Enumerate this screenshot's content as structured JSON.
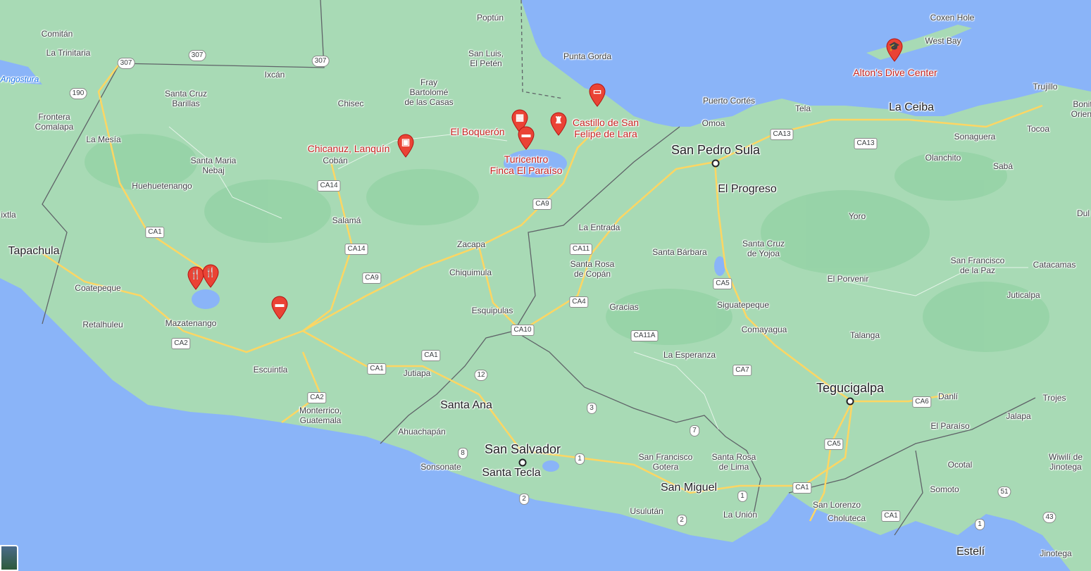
{
  "colors": {
    "water": "#8ab4f8",
    "land": "#a8dab5",
    "land_dark": "#94d2a5",
    "road": "#fdd663",
    "border": "#5f6368",
    "pin": "#ea4335"
  },
  "places": [
    {
      "name": "Comitán",
      "cls": "small"
    },
    {
      "name": "La Trinitaria",
      "cls": "small"
    },
    {
      "name": "Frontera\nComalapa",
      "cls": "small"
    },
    {
      "name": "La Mesía",
      "cls": "small"
    },
    {
      "name": "Santa Cruz\nBarillas",
      "cls": "small"
    },
    {
      "name": "Ixcán",
      "cls": "small"
    },
    {
      "name": "Chisec",
      "cls": "small"
    },
    {
      "name": "Fray\nBartolomé\nde las Casas",
      "cls": "small"
    },
    {
      "name": "Poptún",
      "cls": "small"
    },
    {
      "name": "San Luis,\nEl Petén",
      "cls": "small"
    },
    {
      "name": "Punta Gorda",
      "cls": "small"
    },
    {
      "name": "Santa Maria\nNebaj",
      "cls": "small"
    },
    {
      "name": "Huehuetenango",
      "cls": "small"
    },
    {
      "name": "Cobán",
      "cls": "small"
    },
    {
      "name": "Salamá",
      "cls": "small"
    },
    {
      "name": "Zacapa",
      "cls": "small"
    },
    {
      "name": "Chiquimula",
      "cls": "small"
    },
    {
      "name": "Esquipulas",
      "cls": "small"
    },
    {
      "name": "Jutiapa",
      "cls": "small"
    },
    {
      "name": "Coatepeque",
      "cls": "small"
    },
    {
      "name": "Retalhuleu",
      "cls": "small"
    },
    {
      "name": "Mazatenango",
      "cls": "small"
    },
    {
      "name": "Escuintla",
      "cls": "small"
    },
    {
      "name": "Monterrico,\nGuatemala",
      "cls": "small"
    },
    {
      "name": "Tapachula",
      "cls": "mid"
    },
    {
      "name": "ixtla",
      "cls": "small"
    },
    {
      "name": "Santa Ana",
      "cls": "mid"
    },
    {
      "name": "Ahuachapán",
      "cls": "small"
    },
    {
      "name": "Sonsonate",
      "cls": "small"
    },
    {
      "name": "San Salvador",
      "cls": "big"
    },
    {
      "name": "Santa Tecla",
      "cls": "mid"
    },
    {
      "name": "San Francisco\nGotera",
      "cls": "small"
    },
    {
      "name": "Santa Rosa\nde Lima",
      "cls": "small"
    },
    {
      "name": "San Miguel",
      "cls": "mid"
    },
    {
      "name": "Usulután",
      "cls": "small"
    },
    {
      "name": "La Unión",
      "cls": "small"
    },
    {
      "name": "La Entrada",
      "cls": "small"
    },
    {
      "name": "Santa Rosa\nde Copán",
      "cls": "small"
    },
    {
      "name": "Gracias",
      "cls": "small"
    },
    {
      "name": "Santa Bárbara",
      "cls": "small"
    },
    {
      "name": "Santa Cruz\nde Yojoa",
      "cls": "small"
    },
    {
      "name": "Siguatepeque",
      "cls": "small"
    },
    {
      "name": "Comayagua",
      "cls": "small"
    },
    {
      "name": "La Esperanza",
      "cls": "small"
    },
    {
      "name": "San Pedro Sula",
      "cls": "big"
    },
    {
      "name": "El Progreso",
      "cls": "mid"
    },
    {
      "name": "Puerto Cortés",
      "cls": "small"
    },
    {
      "name": "Omoa",
      "cls": "small"
    },
    {
      "name": "Tela",
      "cls": "small"
    },
    {
      "name": "La Ceiba",
      "cls": "mid"
    },
    {
      "name": "Trujillo",
      "cls": "small"
    },
    {
      "name": "Bonit\nOrient",
      "cls": "small"
    },
    {
      "name": "Sonaguera",
      "cls": "small"
    },
    {
      "name": "Tocoa",
      "cls": "small"
    },
    {
      "name": "Olanchito",
      "cls": "small"
    },
    {
      "name": "Sabá",
      "cls": "small"
    },
    {
      "name": "Yoro",
      "cls": "small"
    },
    {
      "name": "Dul",
      "cls": "small"
    },
    {
      "name": "El Porvenir",
      "cls": "small"
    },
    {
      "name": "San Francisco\nde la Paz",
      "cls": "small"
    },
    {
      "name": "Catacamas",
      "cls": "small"
    },
    {
      "name": "Juticalpa",
      "cls": "small"
    },
    {
      "name": "Talanga",
      "cls": "small"
    },
    {
      "name": "Tegucigalpa",
      "cls": "big"
    },
    {
      "name": "Danlí",
      "cls": "small"
    },
    {
      "name": "Trojes",
      "cls": "small"
    },
    {
      "name": "El Paraíso",
      "cls": "small"
    },
    {
      "name": "Jalapa",
      "cls": "small"
    },
    {
      "name": "Ocotal",
      "cls": "small"
    },
    {
      "name": "Wiwilí de\nJinotega",
      "cls": "small"
    },
    {
      "name": "Somoto",
      "cls": "small"
    },
    {
      "name": "San Lorenzo",
      "cls": "small"
    },
    {
      "name": "Choluteca",
      "cls": "small"
    },
    {
      "name": "Estelí",
      "cls": "mid"
    },
    {
      "name": "Jinotega",
      "cls": "small"
    },
    {
      "name": "Coxen Hole",
      "cls": "small"
    },
    {
      "name": "West Bay",
      "cls": "small"
    },
    {
      "name": "Angostura",
      "cls": "water"
    }
  ],
  "routes": [
    "307",
    "307",
    "307",
    "190",
    "CA14",
    "CA14",
    "CA9",
    "CA9",
    "CA1",
    "CA2",
    "CA2",
    "CA1",
    "CA1",
    "12",
    "3",
    "8",
    "1",
    "2",
    "CA10",
    "CA11",
    "CA4",
    "CA11A",
    "CA5",
    "CA7",
    "CA13",
    "CA13",
    "CA5",
    "CA6",
    "CA1",
    "CA1",
    "7",
    "1",
    "2",
    "51",
    "1",
    "43"
  ],
  "pois": [
    {
      "name": "Alton's Dive Center",
      "icon": "graduation-cap-icon",
      "glyph": "🎓"
    },
    {
      "name": "Castillo de San\nFelipe de Lara",
      "icon": "castle-icon",
      "glyph": "♜"
    },
    {
      "name": "El Boquerón",
      "icon": "landmark-icon",
      "glyph": "▦"
    },
    {
      "name": "Turicentro\nFinca El Paraíso",
      "icon": "bed-icon",
      "glyph": "▬"
    },
    {
      "name": "Chicanuz, Lanquín",
      "icon": "shopping-bag-icon",
      "glyph": "▣"
    },
    {
      "name": "",
      "icon": "bus-icon",
      "glyph": "▭"
    },
    {
      "name": "",
      "icon": "restaurant-icon",
      "glyph": "🍴"
    },
    {
      "name": "",
      "icon": "restaurant-icon",
      "glyph": "🍴"
    },
    {
      "name": "",
      "icon": "bed-icon",
      "glyph": "▬"
    }
  ]
}
